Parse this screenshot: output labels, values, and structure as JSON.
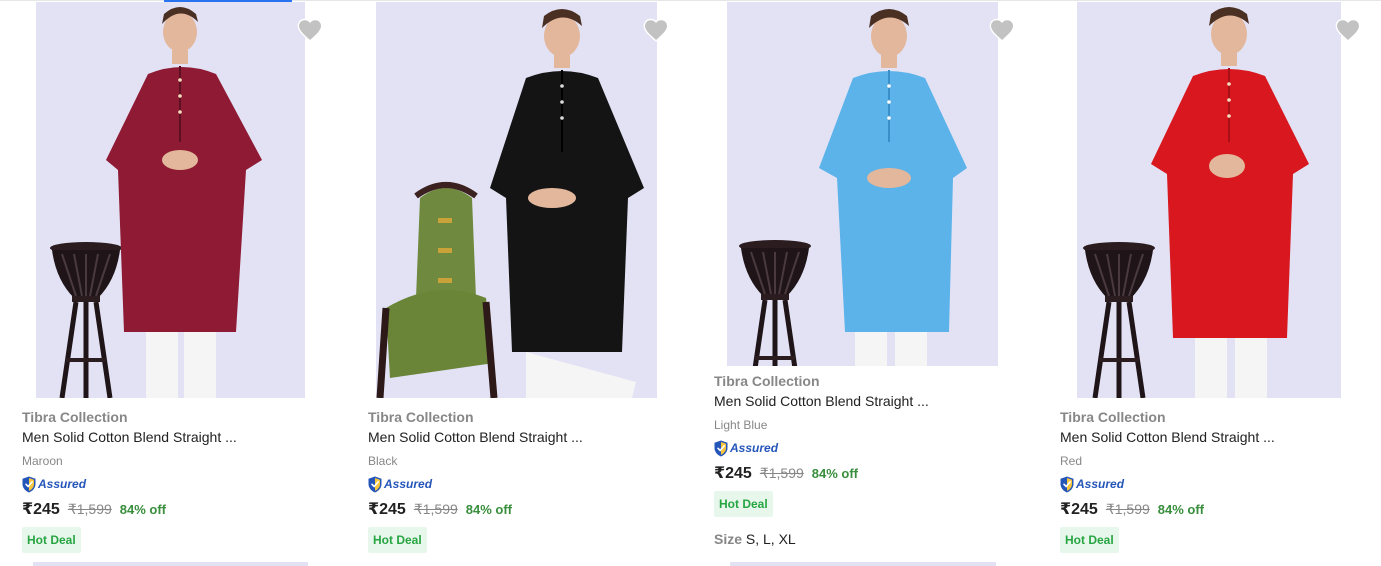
{
  "colors": {
    "image_bg": "#e3e2f5",
    "assured": "#2455b8",
    "discount": "#388e3c",
    "deal_text": "#26a541",
    "deal_bg": "#e8f7ec",
    "maroon": "#8e1a34",
    "black": "#141414",
    "light_blue": "#5cb3ea",
    "red": "#d8171f"
  },
  "products": [
    {
      "brand": "Tibra Collection",
      "title": "Men Solid Cotton Blend Straight ...",
      "color": "Maroon",
      "assured_label": "Assured",
      "price": "₹245",
      "mrp": "₹1,599",
      "discount": "84% off",
      "deal": "Hot Deal",
      "image": "man-in-maroon-kurta-with-stool"
    },
    {
      "brand": "Tibra Collection",
      "title": "Men Solid Cotton Blend Straight ...",
      "color": "Black",
      "assured_label": "Assured",
      "price": "₹245",
      "mrp": "₹1,599",
      "discount": "84% off",
      "deal": "Hot Deal",
      "image": "man-in-black-kurta-with-green-chair"
    },
    {
      "brand": "Tibra Collection",
      "title": "Men Solid Cotton Blend Straight ...",
      "color": "Light Blue",
      "assured_label": "Assured",
      "price": "₹245",
      "mrp": "₹1,599",
      "discount": "84% off",
      "deal": "Hot Deal",
      "size_label": "Size",
      "sizes": "S, L, XL",
      "image": "man-in-light-blue-kurta-with-stool"
    },
    {
      "brand": "Tibra Collection",
      "title": "Men Solid Cotton Blend Straight ...",
      "color": "Red",
      "assured_label": "Assured",
      "price": "₹245",
      "mrp": "₹1,599",
      "discount": "84% off",
      "deal": "Hot Deal",
      "image": "man-in-red-kurta-with-stool"
    }
  ]
}
